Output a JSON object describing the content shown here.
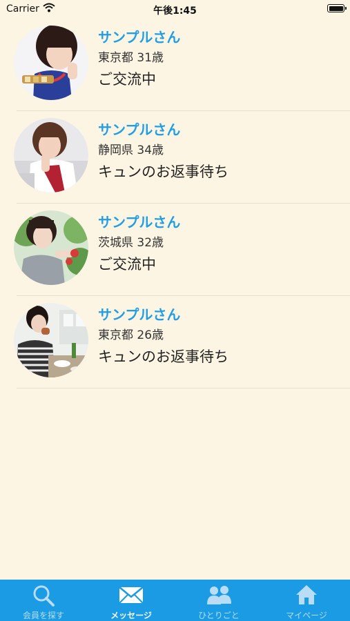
{
  "status_bar": {
    "carrier": "Carrier",
    "time": "午後1:45"
  },
  "messages": [
    {
      "name": "サンプルさん",
      "location": "東京都 31歳",
      "status": "ご交流中",
      "photo": "woman-holding-food-icon"
    },
    {
      "name": "サンプルさん",
      "location": "静岡県 34歳",
      "status": "キュンのお返事待ち",
      "photo": "woman-resting-on-hand-icon"
    },
    {
      "name": "サンプルさん",
      "location": "茨城県 32歳",
      "status": "ご交流中",
      "photo": "woman-outdoors-icon"
    },
    {
      "name": "サンプルさん",
      "location": "東京都 26歳",
      "status": "キュンのお返事待ち",
      "photo": "woman-eating-icon"
    }
  ],
  "tab_bar": {
    "tabs": [
      {
        "label": "会員を探す",
        "icon": "search-icon",
        "active": false
      },
      {
        "label": "メッセージ",
        "icon": "envelope-icon",
        "active": true
      },
      {
        "label": "ひとりごと",
        "icon": "people-icon",
        "active": false
      },
      {
        "label": "マイページ",
        "icon": "home-icon",
        "active": false
      }
    ]
  },
  "colors": {
    "background": "#fdf5e3",
    "accent": "#1a9be3",
    "name_text": "#1f9ee6"
  }
}
